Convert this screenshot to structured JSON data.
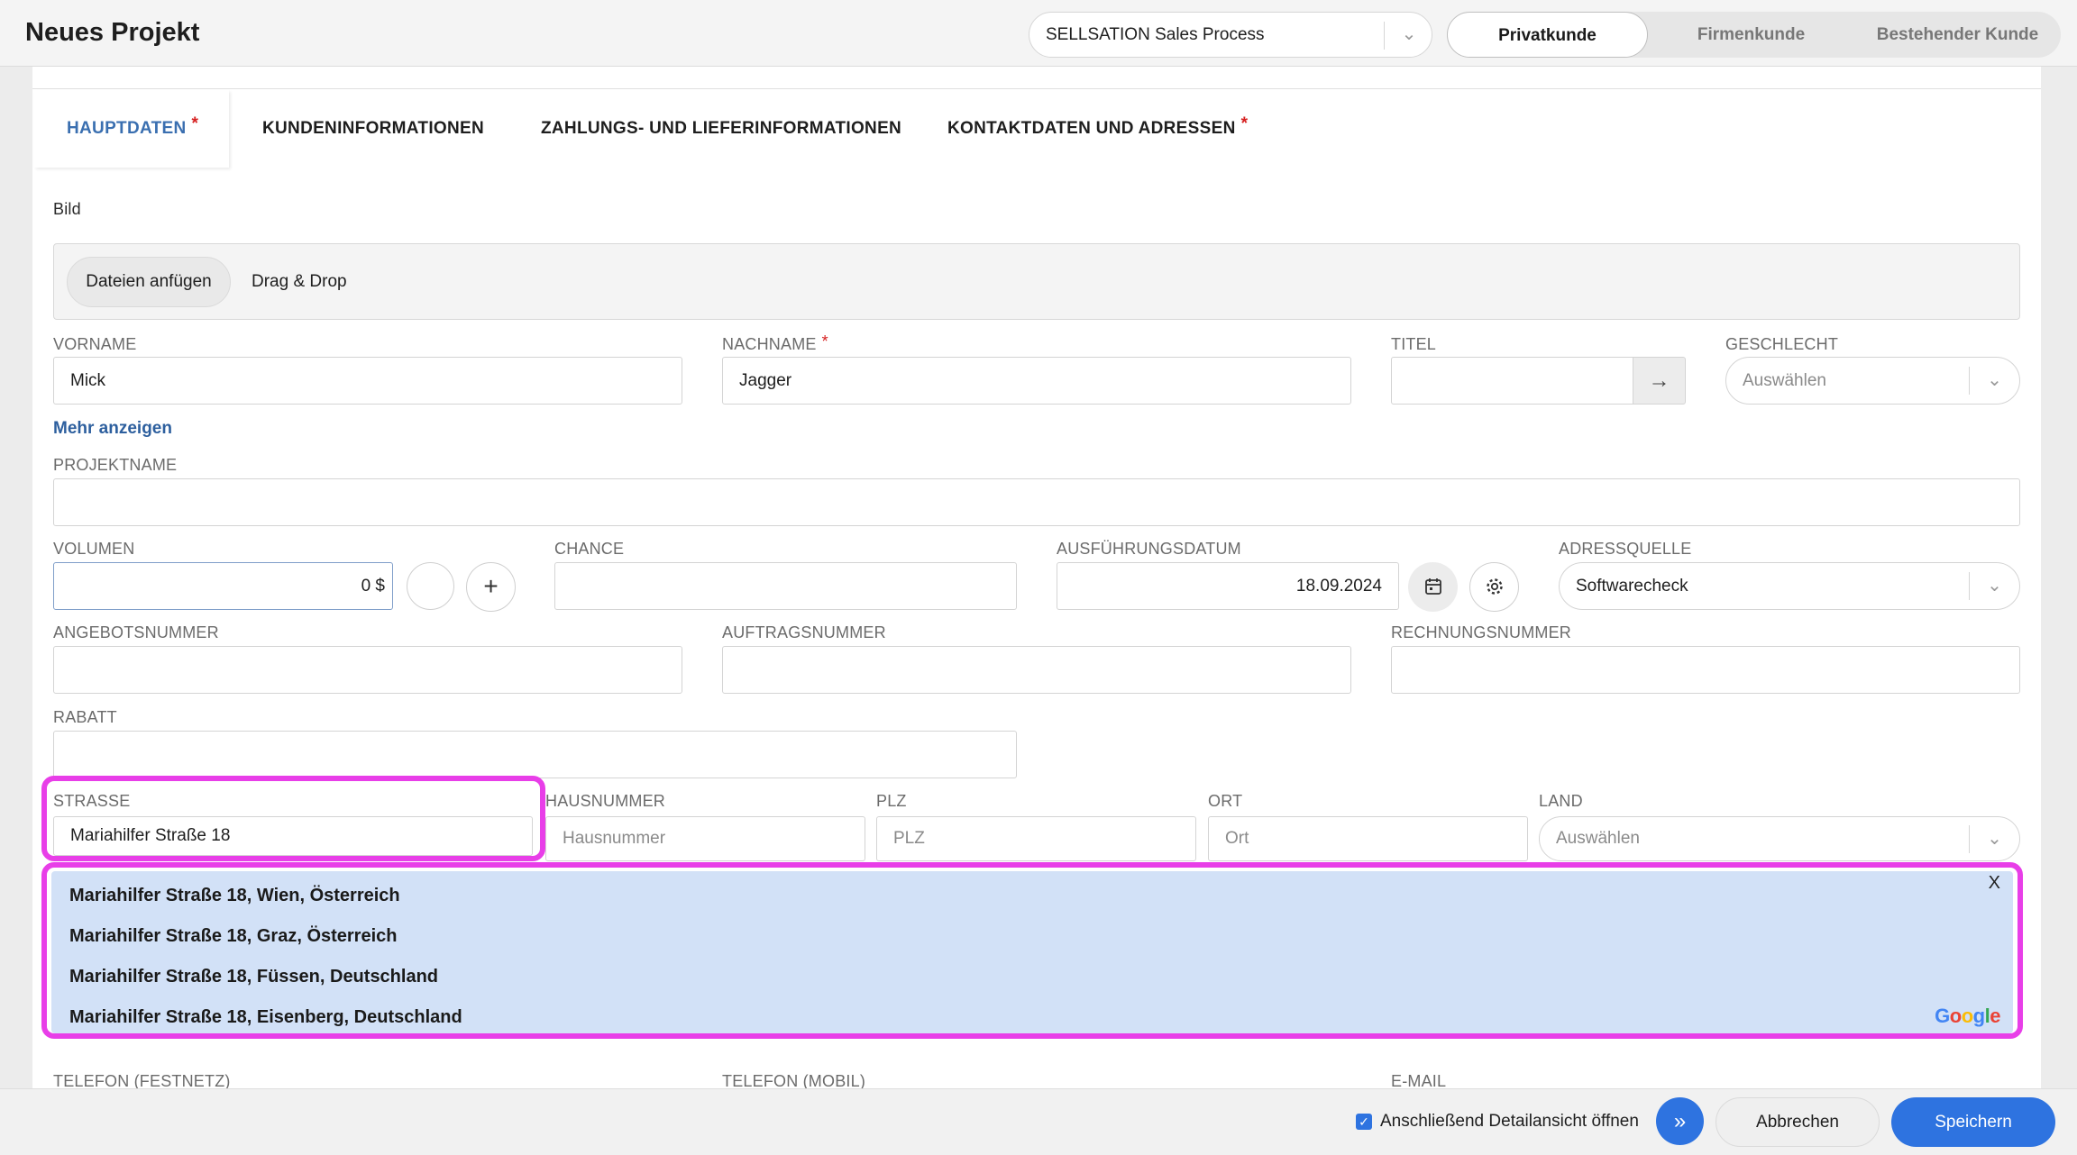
{
  "header": {
    "title": "Neues Projekt",
    "process_select": "SELLSATION Sales Process",
    "segments": [
      "Privatkunde",
      "Firmenkunde",
      "Bestehender Kunde"
    ],
    "active_segment": "Privatkunde"
  },
  "tabs": [
    {
      "label": "HAUPTDATEN",
      "required": "*"
    },
    {
      "label": "KUNDENINFORMATIONEN",
      "required": ""
    },
    {
      "label": "ZAHLUNGS- UND LIEFERINFORMATIONEN",
      "required": ""
    },
    {
      "label": "KONTAKTDATEN UND ADRESSEN",
      "required": "*"
    }
  ],
  "image": {
    "label": "Bild",
    "attach_button": "Dateien anfügen",
    "drag_drop": "Drag & Drop"
  },
  "person": {
    "vorname_label": "VORNAME",
    "vorname_value": "Mick",
    "nachname_label": "NACHNAME",
    "nachname_required": "*",
    "nachname_value": "Jagger",
    "titel_label": "TITEL",
    "titel_value": "",
    "geschlecht_label": "GESCHLECHT",
    "geschlecht_value": "Auswählen",
    "more_link": "Mehr anzeigen"
  },
  "project": {
    "projektname_label": "PROJEKTNAME",
    "projektname_value": "",
    "volumen_label": "VOLUMEN",
    "volumen_value": "0 $",
    "chance_label": "CHANCE",
    "chance_value": "",
    "datum_label": "AUSFÜHRUNGSDATUM",
    "datum_value": "18.09.2024",
    "adressquelle_label": "ADRESSQUELLE",
    "adressquelle_value": "Softwarecheck",
    "angebot_label": "ANGEBOTSNUMMER",
    "angebot_value": "",
    "auftrag_label": "AUFTRAGSNUMMER",
    "auftrag_value": "",
    "rechnung_label": "RECHNUNGSNUMMER",
    "rechnung_value": "",
    "rabatt_label": "RABATT",
    "rabatt_value": ""
  },
  "address": {
    "strasse_label": "STRASSE",
    "strasse_value": "Mariahilfer Straße 18",
    "hausnummer_label": "HAUSNUMMER",
    "hausnummer_placeholder": "Hausnummer",
    "plz_label": "PLZ",
    "plz_placeholder": "PLZ",
    "ort_label": "ORT",
    "ort_placeholder": "Ort",
    "land_label": "LAND",
    "land_value": "Auswählen"
  },
  "suggestions": {
    "items": [
      "Mariahilfer Straße 18, Wien, Österreich",
      "Mariahilfer Straße 18, Graz, Österreich",
      "Mariahilfer Straße 18, Füssen, Deutschland",
      "Mariahilfer Straße 18, Eisenberg, Deutschland"
    ],
    "close": "X",
    "attribution": "Google"
  },
  "contact": {
    "festnetz_label": "TELEFON (FESTNETZ)",
    "mobil_label": "TELEFON (MOBIL)",
    "email_label": "E-MAIL"
  },
  "footer": {
    "checkbox_label": "Anschließend Detailansicht öffnen",
    "cancel": "Abbrechen",
    "save": "Speichern"
  },
  "colors": {
    "accent": "#2e73e0",
    "highlight": "#e83ee8",
    "suggestion_bg": "#d2e1f7",
    "required": "#d62020"
  }
}
